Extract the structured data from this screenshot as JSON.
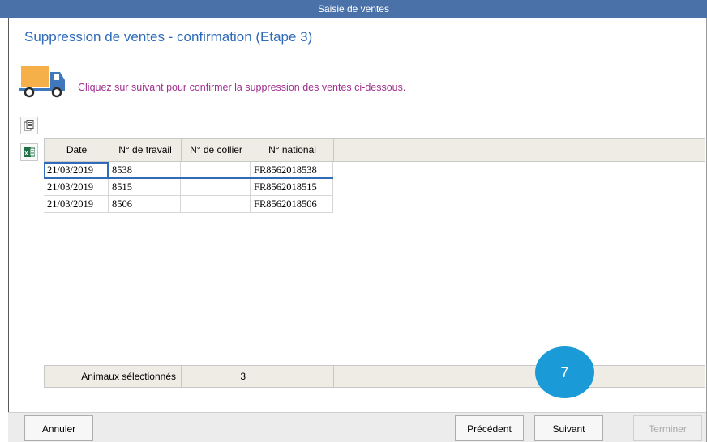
{
  "window": {
    "title": "Saisie de ventes"
  },
  "heading": "Suppression de ventes - confirmation (Etape 3)",
  "instruction": "Cliquez sur suivant pour confirmer la suppression des ventes ci-dessous.",
  "toolbar": {
    "icons": [
      "copy-icon",
      "excel-icon"
    ]
  },
  "grid": {
    "columns": [
      "Date",
      "N° de travail",
      "N° de collier",
      "N° national"
    ],
    "rows": [
      [
        "21/03/2019",
        "8538",
        "",
        "FR8562018538"
      ],
      [
        "21/03/2019",
        "8515",
        "",
        "FR8562018515"
      ],
      [
        "21/03/2019",
        "8506",
        "",
        "FR8562018506"
      ]
    ],
    "footer": {
      "label": "Animaux sélectionnés",
      "count": "3"
    }
  },
  "badge": "7",
  "buttons": {
    "cancel": "Annuler",
    "previous": "Précédent",
    "next": "Suivant",
    "finish": "Terminer"
  },
  "colors": {
    "title_bar": "#4a72a8",
    "heading": "#2f6bb8",
    "instruction": "#a0308f",
    "badge": "#1a9bd7",
    "truck": "#f5b04a"
  }
}
